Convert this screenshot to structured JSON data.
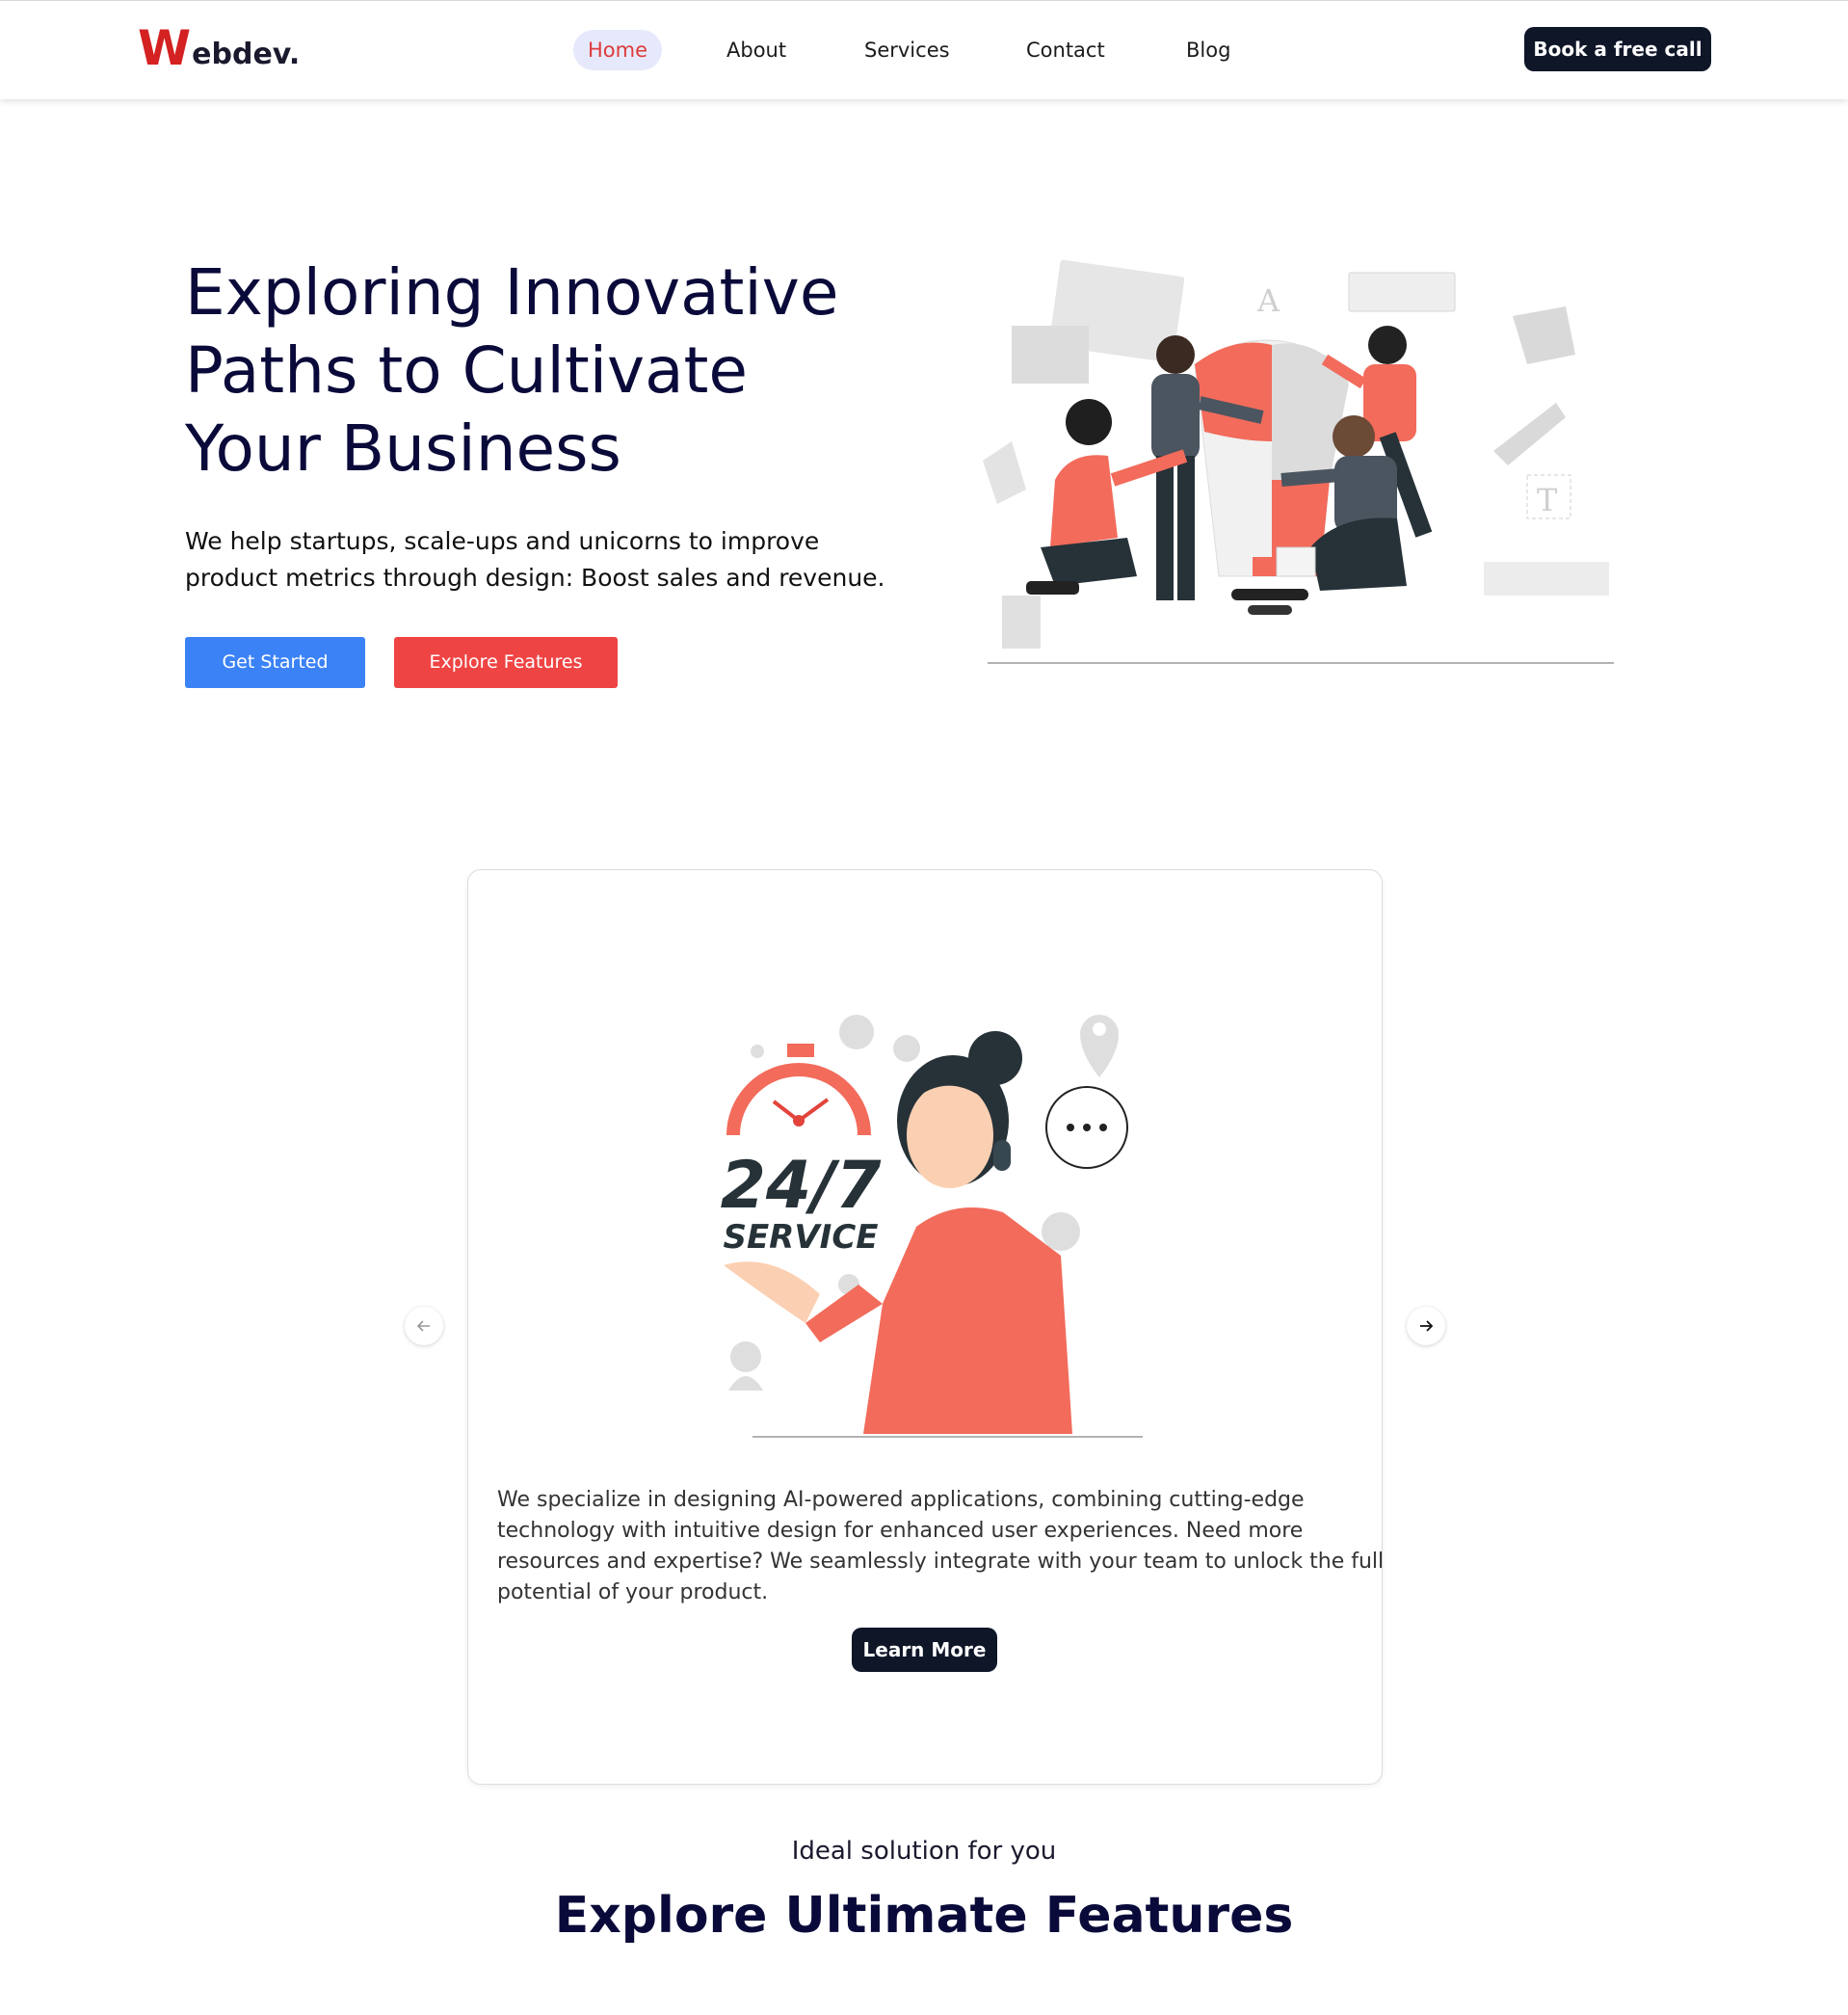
{
  "header": {
    "logo_initial": "W",
    "logo_rest": "ebdev.",
    "nav": [
      {
        "label": "Home",
        "active": true
      },
      {
        "label": "About"
      },
      {
        "label": "Services"
      },
      {
        "label": "Contact"
      },
      {
        "label": "Blog"
      }
    ],
    "cta_label": "Book a free call"
  },
  "hero": {
    "title_lines": [
      "Exploring Innovative",
      "Paths to Cultivate",
      "Your Business"
    ],
    "subtitle_lines": [
      "We help startups, scale-ups and unicorns to improve",
      "product metrics through design: Boost sales and revenue."
    ],
    "primary_button": "Get Started",
    "secondary_button": "Explore Features",
    "illustration": "team-assembling-puzzle-lightbulb"
  },
  "card": {
    "illustration_text": {
      "big": "24/7",
      "small": "SERVICE"
    },
    "description_lines": [
      "We specialize in designing AI-powered applications, combining cutting-edge",
      "technology with intuitive design for enhanced user experiences. Need more",
      "resources and expertise? We seamlessly integrate with your team to unlock the full",
      "potential of your product."
    ],
    "button_label": "Learn More",
    "prev_icon": "arrow-left-icon",
    "next_icon": "arrow-right-icon"
  },
  "features": {
    "eyebrow": "Ideal solution for you",
    "title": "Explore Ultimate Features"
  },
  "colors": {
    "brand_red": "#d42121",
    "primary_blue": "#3b82f6",
    "accent_red": "#ef4444",
    "dark": "#0e1628",
    "heading": "#0a0a3a",
    "illustration_coral": "#f26b5b"
  }
}
